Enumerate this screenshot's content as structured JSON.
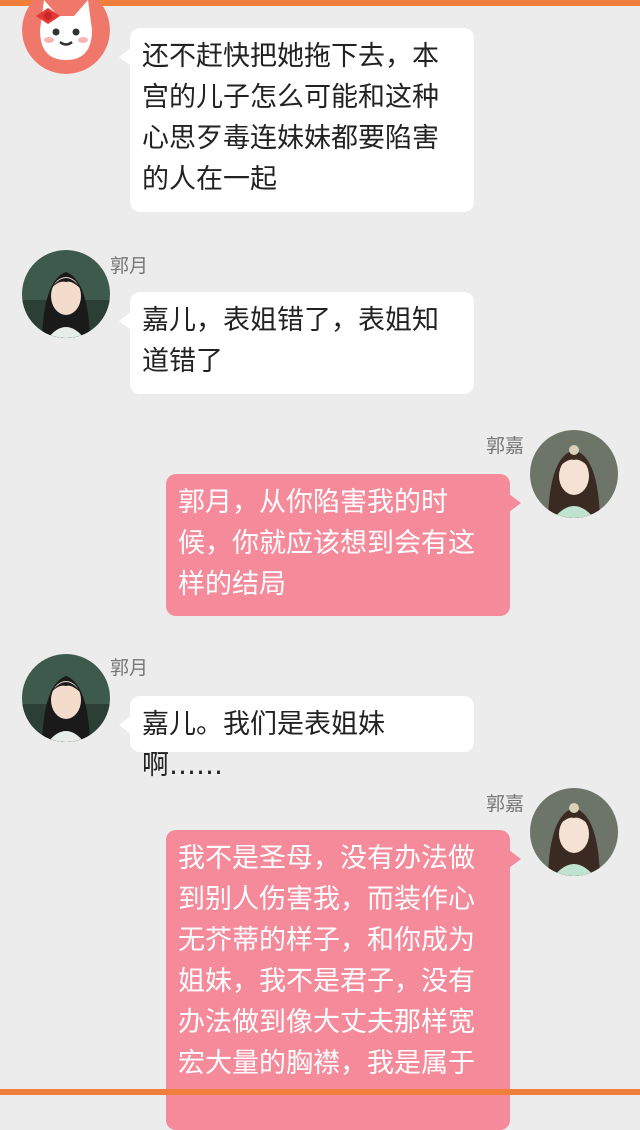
{
  "colors": {
    "background": "#ececec",
    "accent_bar": "#f07f3c",
    "bubble_left": "#ffffff",
    "bubble_right": "#f48a9a"
  },
  "messages": [
    {
      "sender": "",
      "side": "left",
      "avatar": "cartoon-cat-avatar-icon",
      "text": "还不赶快把她拖下去，本宫的儿子怎么可能和这种心思歹毒连妹妹都要陷害的人在一起"
    },
    {
      "sender": "郭月",
      "side": "left",
      "avatar": "guo-yue-avatar",
      "text": "嘉儿，表姐错了，表姐知道错了"
    },
    {
      "sender": "郭嘉",
      "side": "right",
      "avatar": "guo-jia-avatar",
      "text": "郭月，从你陷害我的时候，你就应该想到会有这样的结局"
    },
    {
      "sender": "郭月",
      "side": "left",
      "avatar": "guo-yue-avatar",
      "text": "嘉儿。我们是表姐妹啊……"
    },
    {
      "sender": "郭嘉",
      "side": "right",
      "avatar": "guo-jia-avatar",
      "text": "我不是圣母，没有办法做到别人伤害我，而装作心无芥蒂的样子，和你成为姐妹，我不是君子，没有办法做到像大丈夫那样宽宏大量的胸襟，我是属于"
    }
  ]
}
